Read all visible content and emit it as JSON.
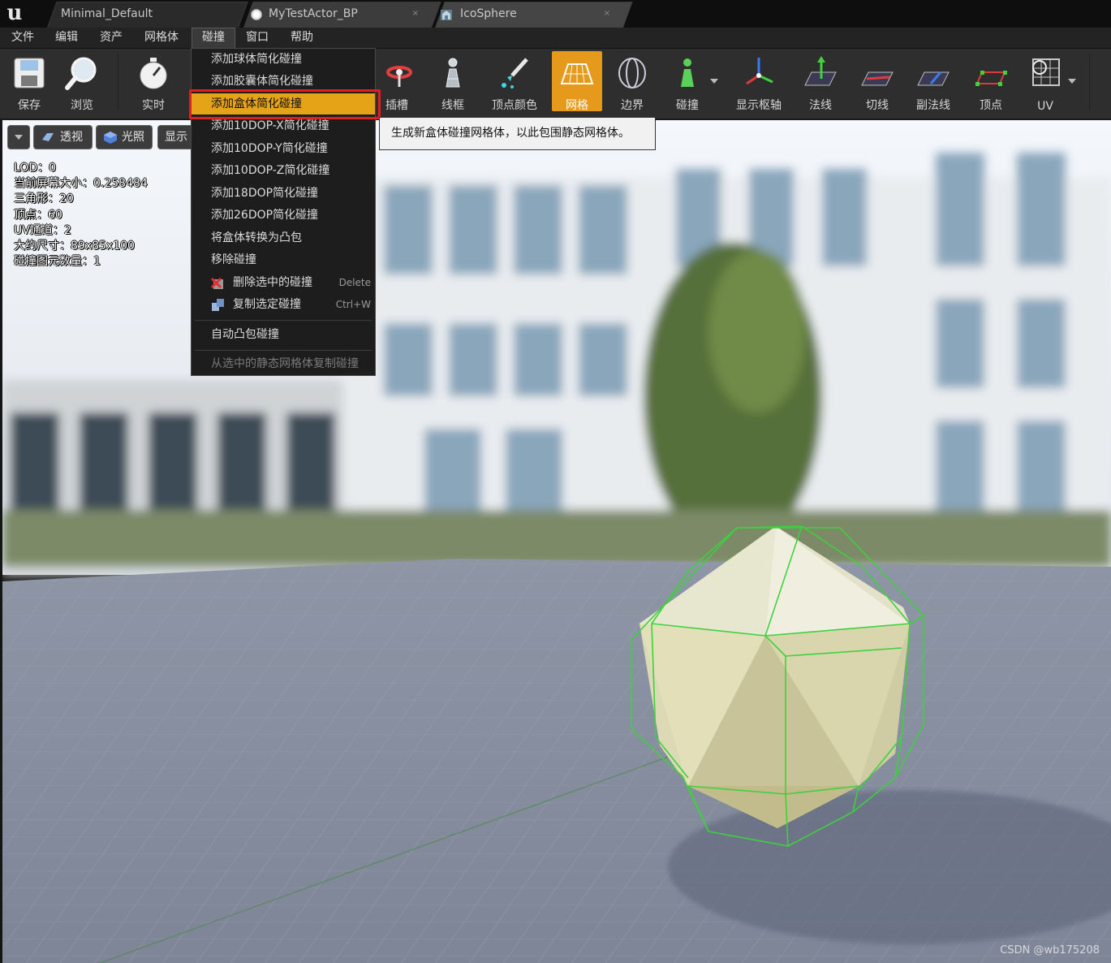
{
  "tabs": [
    {
      "label": "Minimal_Default",
      "close": ""
    },
    {
      "label": "MyTestActor_BP",
      "close": "×"
    },
    {
      "label": "IcoSphere",
      "close": "×"
    }
  ],
  "menubar": [
    "文件",
    "编辑",
    "资产",
    "网格体",
    "碰撞",
    "窗口",
    "帮助"
  ],
  "toolbar": {
    "save": "保存",
    "browse": "浏览",
    "realtime": "实时",
    "socket": "插槽",
    "wireframe": "线框",
    "vertex_color": "顶点颜色",
    "grid": "网格",
    "bounds": "边界",
    "collision": "碰撞",
    "pivot": "显示枢轴",
    "normals": "法线",
    "tangents": "切线",
    "binormals": "副法线",
    "vertices": "顶点",
    "uv": "UV"
  },
  "viewport_controls": {
    "perspective": "透视",
    "lit": "光照",
    "show": "显示"
  },
  "stats": [
    "LOD：0",
    "当前屏幕大小：0.258484",
    "三角形：20",
    "顶点：60",
    "UV通道：2",
    "大约尺寸：89x85x100",
    "碰撞图元数量：1"
  ],
  "dropdown": {
    "items": [
      "添加球体简化碰撞",
      "添加胶囊体简化碰撞",
      "添加盒体简化碰撞",
      "添加10DOP-X简化碰撞",
      "添加10DOP-Y简化碰撞",
      "添加10DOP-Z简化碰撞",
      "添加18DOP简化碰撞",
      "添加26DOP简化碰撞",
      "将盒体转换为凸包",
      "移除碰撞"
    ],
    "delete_label": "删除选中的碰撞",
    "delete_shortcut": "Delete",
    "copy_label": "复制选定碰撞",
    "copy_shortcut": "Ctrl+W",
    "auto_convex": "自动凸包碰撞",
    "copy_from_selected": "从选中的静态网格体复制碰撞"
  },
  "tooltip": "生成新盒体碰撞网格体，以此包围静态网格体。",
  "watermark": "CSDN @wb175208",
  "colors": {
    "accent": "#e5a317",
    "highlight_frame": "#e0201e",
    "collision_wire": "#3ed13e",
    "mesh": "#e8e6c4"
  }
}
